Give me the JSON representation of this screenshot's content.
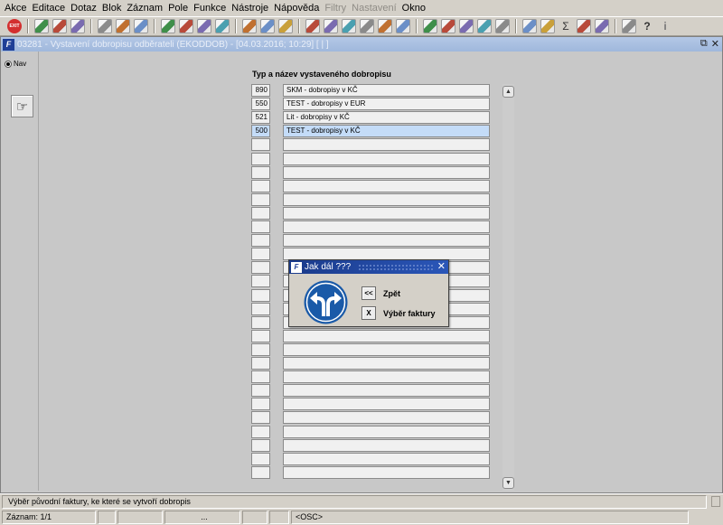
{
  "menu": {
    "items": [
      {
        "label": "Akce",
        "enabled": true
      },
      {
        "label": "Editace",
        "enabled": true
      },
      {
        "label": "Dotaz",
        "enabled": true
      },
      {
        "label": "Blok",
        "enabled": true
      },
      {
        "label": "Záznam",
        "enabled": true
      },
      {
        "label": "Pole",
        "enabled": true
      },
      {
        "label": "Funkce",
        "enabled": true
      },
      {
        "label": "Nástroje",
        "enabled": true
      },
      {
        "label": "Nápověda",
        "enabled": true
      },
      {
        "label": "Filtry",
        "enabled": false
      },
      {
        "label": "Nastavení",
        "enabled": false
      },
      {
        "label": "Okno",
        "enabled": true
      }
    ]
  },
  "toolbar": {
    "exit_label": "EXIT",
    "icons": [
      "exit-icon",
      "sep",
      "save-icon",
      "new-record-icon",
      "delete-record-icon",
      "sep",
      "query-icon",
      "execute-query-icon",
      "cancel-query-icon",
      "sep",
      "sort-asc-icon",
      "sort-desc-icon",
      "wrench-icon",
      "filter-icon",
      "sep",
      "print-icon",
      "attach-icon",
      "email-icon",
      "sep",
      "cut-icon",
      "copy-icon",
      "paste-icon",
      "edit-icon",
      "list-icon",
      "table-icon",
      "sep",
      "calculator-icon",
      "document-icon",
      "package-icon",
      "settings-icon",
      "warning-icon",
      "sep",
      "chart-icon",
      "calendar-icon",
      "sum-icon",
      "excel-icon",
      "word-icon",
      "sep",
      "key-icon",
      "help-icon",
      "info-icon"
    ],
    "sum_glyph": "Σ",
    "help_glyph": "?",
    "info_glyph": "i"
  },
  "window": {
    "title": "03281 - Vystavení dobropisu odběrateli (EKODDOB) - [04.03.2016; 10:29] [ | ]",
    "restore_glyph": "⧉",
    "close_glyph": "✕"
  },
  "left_panel": {
    "nav_label": "Nav"
  },
  "list": {
    "header": "Typ a název vystaveného dobropisu",
    "selected_index": 3,
    "row_count": 29,
    "rows": [
      {
        "code": "890",
        "name": "SKM - dobropisy v KČ"
      },
      {
        "code": "550",
        "name": "TEST - dobropisy v EUR"
      },
      {
        "code": "521",
        "name": "Lit - dobropisy v KČ"
      },
      {
        "code": "500",
        "name": "TEST - dobropisy v KČ"
      }
    ]
  },
  "dialog": {
    "title": "Jak dál ???",
    "close_glyph": "✕",
    "back_button": "<<",
    "back_label": "Zpět",
    "select_button": "X",
    "select_label": "Výběr faktury"
  },
  "status": {
    "message": "Výběr původní faktury, ke které se vytvoří dobropis",
    "record": "Záznam: 1/1",
    "cell_dots": "...",
    "mode": "<OSC>"
  },
  "colors": {
    "titlebar": "#9fb8dc",
    "dialog_titlebar": "#1a3a8a",
    "selected_row": "#c4dcf8",
    "sign_blue": "#1a5aa8"
  }
}
